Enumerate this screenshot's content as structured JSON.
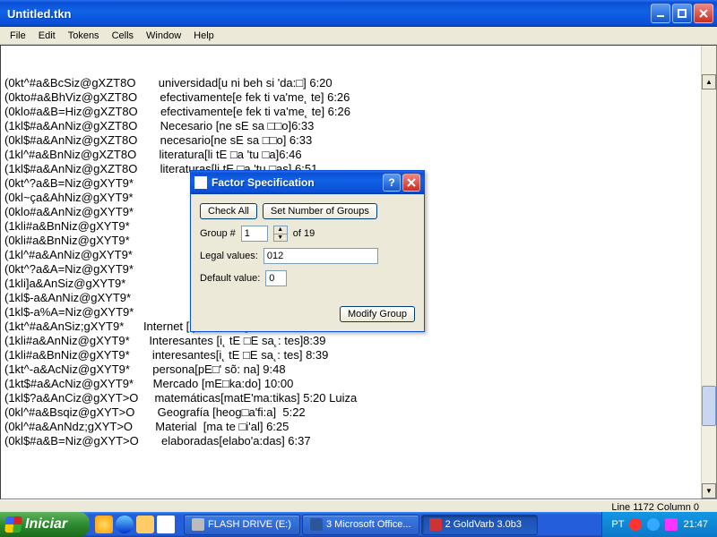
{
  "window": {
    "title": "Untitled.tkn"
  },
  "menu": [
    "File",
    "Edit",
    "Tokens",
    "Cells",
    "Window",
    "Help"
  ],
  "lines": [
    "(0kt^#a&BcSiz@gXZT8O       universidad[u ni beh si 'da:□] 6:20",
    "(0kto#a&BhViz@gXZT8O       efectivamente[e fek ti va'me˛ te] 6:26",
    "(0klo#a&B=Hiz@gXZT8O       efectivamente[e fek ti va'me˛ te] 6:26",
    "(1kl$#a&AnNiz@gXZT8O       Necesario [ne sE sa □□o]6:33",
    "(0kl$#a&AnNiz@gXZT8O       necesario[ne sE sa □□o] 6:33",
    "(1kl^#a&BnNiz@gXZT8O       literatura[li tE □a 'tu □a]6:46",
    "(1kl$#a&AnNiz@gXZT8O       literaturas[li tE □a 'tu □as] 6:51",
    "(0kt^?a&B=Niz@gXYT9*                               29 Lorena",
    "(0kl~ça&AhNiz@gXYT9*                               es]5:31",
    "(0klo#a&AnNiz@gXYT9*                               5:42",
    "(1kli#a&BnNiz@gXYT9*                               ta˛ mos] 6:48",
    "(0kli#a&BnNiz@gXYT9*                               a˛ mos] 6:48",
    "(1kl^#a&AnNiz@gXYT9*                               6:50",
    "(0kt^?a&A=Niz@gXYT9*                               54",
    "(1kli]a&AnSiz@gXYT9*                               a˛nE'ha˛:do:]7:00PLM",
    "(1kl$-a&AnNiz@gXYT9*                               a:to] 7:55",
    "(1kl$-a%A=Niz@gXYT9*",
    "(1kt^#a&AnSiz;gXYT9*      Internet [i˛ tEh ne: ti] 8:36",
    "(1kli#a&AnNiz@gXYT9*      Interesantes [i˛ tE □E sa˛: tes]8:39",
    "(1kli#a&BnNiz@gXYT9*       interesantes[i˛ tE □E sa˛: tes] 8:39",
    "(1kt^-a&AcNiz@gXYT9*       persona[pE□' sõ: na] 9:48",
    "(1kt$#a&AcNiz@gXYT9*      Mercado [mE□ka:do] 10:00",
    "(1kl$?a&AnCiz@gXYT>O     matemáticas[matE'ma:tikas] 5:20 Luiza",
    "(0kl^#a&Bsqiz@gXYT>O       Geografía [heog□a'fi:a]  5:22",
    "(0kl^#a&AnNdz;gXYT>O       Material  [ma te □i'al] 6:25",
    "(0kl$#a&B=Niz@gXYT>O       elaboradas[elabo'a:das] 6:37"
  ],
  "status": "Line 1172 Column 0",
  "dialog": {
    "title": "Factor Specification",
    "check_all": "Check All",
    "set_groups": "Set Number of Groups",
    "group_label": "Group #",
    "group_value": "1",
    "group_of": "of 19",
    "legal_label": "Legal values:",
    "legal_value": "012",
    "default_label": "Default value:",
    "default_value": "0",
    "modify": "Modify Group"
  },
  "taskbar": {
    "start": "Iniciar",
    "items": [
      {
        "label": "FLASH DRIVE (E:)"
      },
      {
        "label": "3 Microsoft Office..."
      },
      {
        "label": "2 GoldVarb 3.0b3"
      }
    ],
    "lang": "PT",
    "clock": "21:47"
  }
}
